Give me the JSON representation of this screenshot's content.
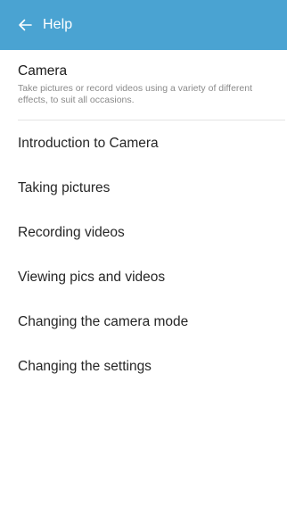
{
  "app_bar": {
    "title": "Help",
    "back_icon": "arrow-left-icon",
    "background_color": "#4aa3d2"
  },
  "section": {
    "title": "Camera",
    "description": "Take pictures or record videos using a variety of different effects, to suit all occasions."
  },
  "topics": [
    {
      "label": "Introduction to Camera"
    },
    {
      "label": "Taking pictures"
    },
    {
      "label": "Recording videos"
    },
    {
      "label": "Viewing pics and videos"
    },
    {
      "label": "Changing the camera mode"
    },
    {
      "label": "Changing the settings"
    }
  ]
}
